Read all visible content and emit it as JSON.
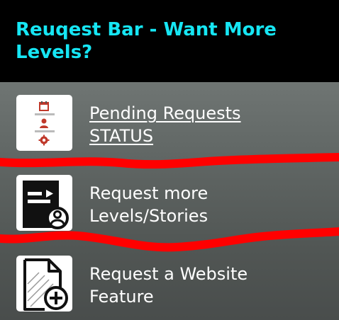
{
  "header": {
    "title": "Reuqest Bar - Want More Levels?"
  },
  "items": [
    {
      "label": "Pending Requests\nSTATUS",
      "icon": "pending-requests-thumbnail"
    },
    {
      "label": "Request more\nLevels/Stories",
      "icon": "document-user-icon"
    },
    {
      "label": "Request a Website\nFeature",
      "icon": "document-add-icon"
    }
  ],
  "colors": {
    "title": "#16e6f4",
    "annotation_stroke": "#ff0000",
    "label_text": "#ffffff"
  }
}
